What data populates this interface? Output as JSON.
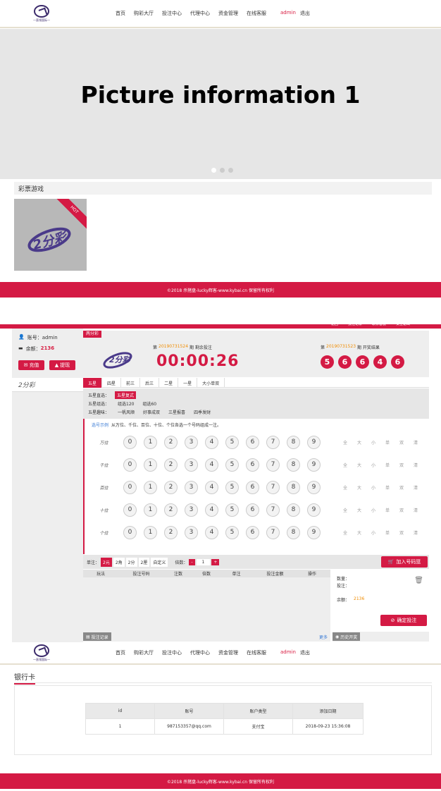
{
  "top_nav": {
    "logo_text": "一直领国际一",
    "links": [
      "首页",
      "购彩大厅",
      "投注中心",
      "代理中心",
      "资金管理",
      "在线客服"
    ],
    "user": "admin",
    "logout": "退出"
  },
  "banner": {
    "text": "Picture information 1",
    "dots": 3,
    "active_dot": 0
  },
  "games_section": {
    "title": "彩票游戏",
    "game_badge": "HOT",
    "game_name": "2分彩"
  },
  "footer": {
    "text": "©2018 杀猪盘-lucky辉客-www.kybai.cn 保留所有权利"
  },
  "game_page": {
    "top_links": [
      "返回",
      "投注记录",
      "联系客服",
      "安全退出"
    ],
    "account_label": "账号：admin",
    "balance_label": "余额：",
    "balance_value": "2136",
    "recharge_btn": "充值",
    "withdraw_btn": "提现",
    "sidebar_item": "2分彩",
    "game_tag": "两分彩",
    "issue_prefix": "第",
    "current_issue": "20190731524",
    "current_suffix": "期 剩余投注",
    "countdown": "00:00:26",
    "last_issue": "20190731523",
    "last_suffix": "期 开奖结果",
    "result_balls": [
      "5",
      "6",
      "6",
      "4",
      "6"
    ],
    "tabs": [
      "五星",
      "四星",
      "前三",
      "后三",
      "二星",
      "一星",
      "大小单双"
    ],
    "sub_rows": [
      {
        "label": "五星直选：",
        "items": [
          "五星复式"
        ]
      },
      {
        "label": "五星组选：",
        "items": [
          "组选120",
          "组选60"
        ]
      },
      {
        "label": "五星趣味：",
        "items": [
          "一帆风顺",
          "好事成双",
          "三星报喜",
          "四季发财"
        ]
      }
    ],
    "example_link": "选号示例",
    "instruction": "从万位、千位、百位、十位、个位各选一个号码组成一注。",
    "positions": [
      "万位",
      "千位",
      "百位",
      "十位",
      "个位"
    ],
    "digits": [
      "0",
      "1",
      "2",
      "3",
      "4",
      "5",
      "6",
      "7",
      "8",
      "9"
    ],
    "quick": [
      "全",
      "大",
      "小",
      "单",
      "双",
      "清"
    ],
    "unit_label": "单注：",
    "units": [
      "2元",
      "2角",
      "2分",
      "2厘",
      "自定义"
    ],
    "multiple_label": "倍数：",
    "multiple_value": "1",
    "add_basket_btn": "加入号码篮",
    "table_headers": [
      "玩法",
      "投注号码",
      "注数",
      "倍数",
      "单注",
      "投注金额",
      "操作"
    ],
    "summary_qty": "数量：",
    "summary_bet": "投注：",
    "summary_balance": "余额：",
    "summary_balance_value": "2136",
    "confirm_btn": "确定投注",
    "records_btn": "投注记录",
    "more_link": "更多",
    "history_btn": "历史开奖"
  },
  "bank_page": {
    "title": "银行卡",
    "headers": [
      "id",
      "账号",
      "账户类型",
      "添加日期"
    ],
    "rows": [
      [
        "1",
        "987153357@qq.com",
        "支付宝",
        "2018-09-23 15:36:08"
      ]
    ]
  }
}
